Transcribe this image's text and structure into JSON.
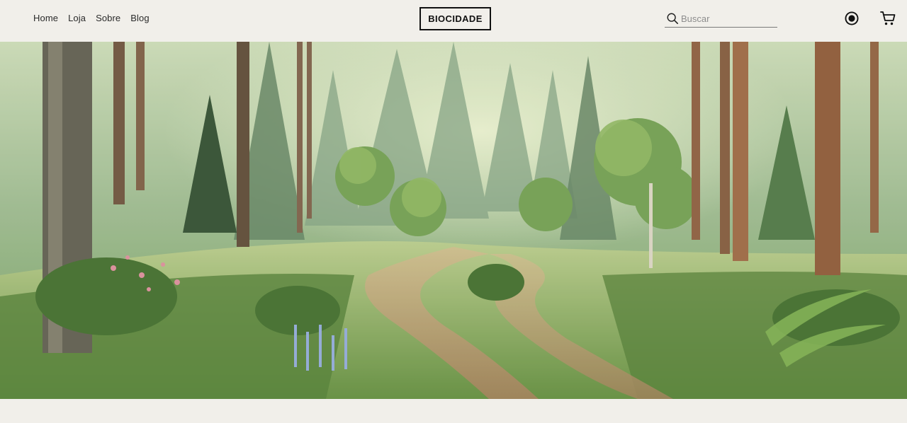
{
  "nav": {
    "items": [
      {
        "label": "Home"
      },
      {
        "label": "Loja"
      },
      {
        "label": "Sobre"
      },
      {
        "label": "Blog"
      }
    ]
  },
  "brand": {
    "logo_text": "BIOCIDADE"
  },
  "search": {
    "placeholder": "Buscar",
    "value": "",
    "icon": "search-icon"
  },
  "actions": {
    "user_icon": "user-circle-icon",
    "cart_icon": "shopping-cart-icon"
  },
  "hero": {
    "image_subject": "forest-path-illustration"
  },
  "colors": {
    "background": "#f1efea",
    "text": "#1b1b1b",
    "logo_border": "#111111",
    "forest_light": "#cfe0b0",
    "forest_dark": "#2f4a2c"
  }
}
